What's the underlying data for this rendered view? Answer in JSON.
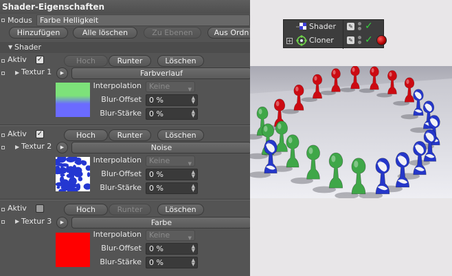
{
  "panel": {
    "title": "Shader-Eigenschaften",
    "modus": {
      "label": "Modus",
      "value": "Farbe Helligkeit"
    },
    "toolbar": {
      "hinzufuegen": "Hinzufügen",
      "alle_loeschen": "Alle löschen",
      "zu_ebenen": "Zu Ebenen",
      "aus_ordner": "Aus Ordn"
    },
    "shader_section": "Shader",
    "common": {
      "aktiv": "Aktiv",
      "hoch": "Hoch",
      "runter": "Runter",
      "loeschen": "Löschen",
      "interpolation": "Interpolation",
      "blur_offset": "Blur-Offset",
      "blur_staerke": "Blur-Stärke",
      "keine": "Keine"
    },
    "layers": [
      {
        "textur": "Textur 1",
        "shader": "Farbverlauf",
        "aktiv": true,
        "blur_offset": "0 %",
        "blur_staerke": "0 %",
        "colors": {
          "top": "#7de27a",
          "bottom": "#6b6bff"
        }
      },
      {
        "textur": "Textur 2",
        "shader": "Noise",
        "aktiv": true,
        "blur_offset": "0 %",
        "blur_staerke": "0 %",
        "colors": {
          "a": "#2437d1",
          "b": "#ffffff"
        }
      },
      {
        "textur": "Textur 3",
        "shader": "Farbe",
        "aktiv": false,
        "blur_offset": "0 %",
        "blur_staerke": "0 %",
        "colors": {
          "fill": "#ff0000"
        }
      }
    ]
  },
  "object_manager": {
    "items": [
      {
        "name": "Shader",
        "icon": "checker-icon"
      },
      {
        "name": "Cloner",
        "icon": "cloner-icon"
      }
    ],
    "colors": {
      "check": "#36d13e",
      "material": "#b00000"
    }
  },
  "render": {
    "colors": {
      "red": "#cc0a12",
      "green": "#3fa748",
      "blue": "#2537c9"
    }
  }
}
